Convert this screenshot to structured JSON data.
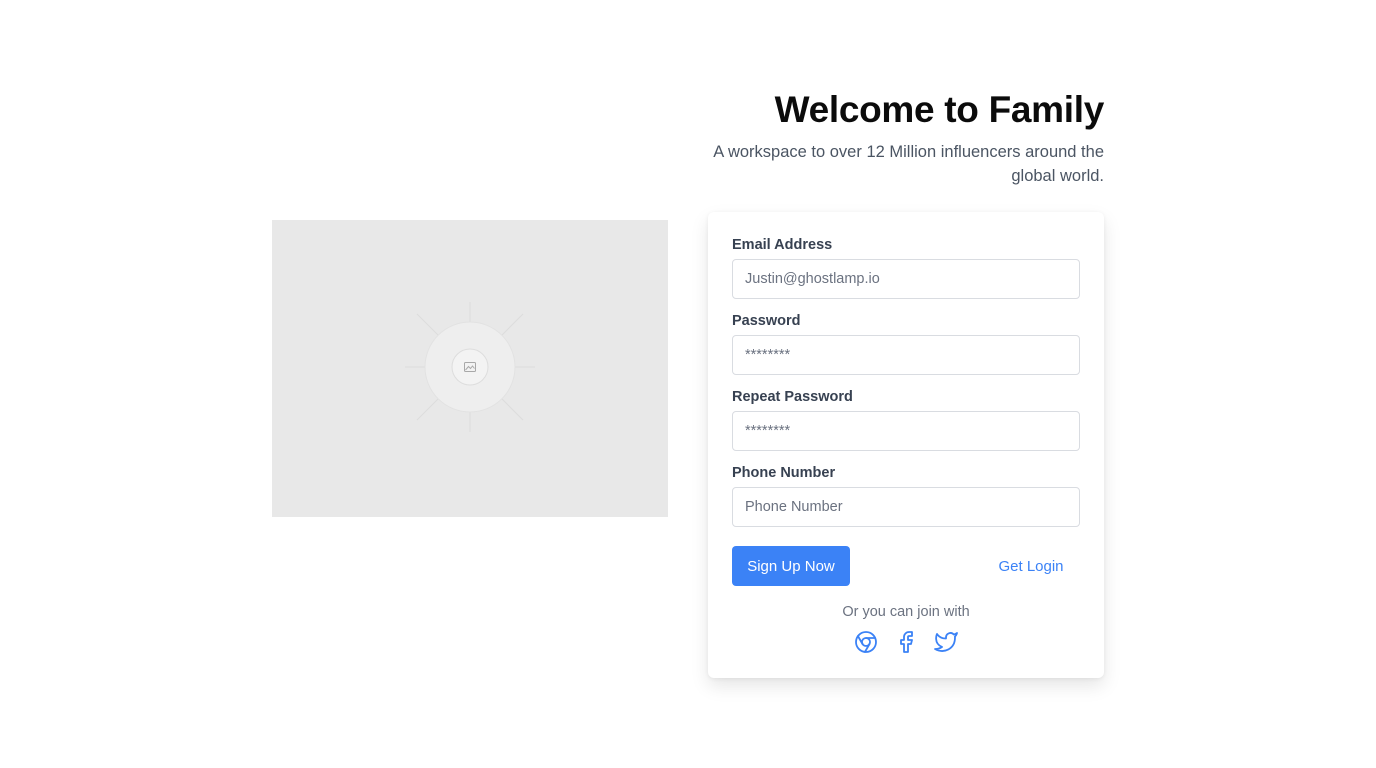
{
  "header": {
    "title": "Welcome to Family",
    "subtitle": "A workspace to over 12 Million influencers around the global world."
  },
  "form": {
    "email": {
      "label": "Email Address",
      "placeholder": "Justin@ghostlamp.io"
    },
    "password": {
      "label": "Password",
      "placeholder": "********"
    },
    "repeat_password": {
      "label": "Repeat Password",
      "placeholder": "********"
    },
    "phone": {
      "label": "Phone Number",
      "placeholder": "Phone Number"
    },
    "signup_label": "Sign Up Now",
    "login_label": "Get Login",
    "join_text": "Or you can join with"
  },
  "social": [
    {
      "icon": "chrome-icon"
    },
    {
      "icon": "facebook-icon"
    },
    {
      "icon": "twitter-icon"
    }
  ],
  "colors": {
    "accent": "#3b82f6",
    "placeholder_bg": "#e8e8e8"
  }
}
